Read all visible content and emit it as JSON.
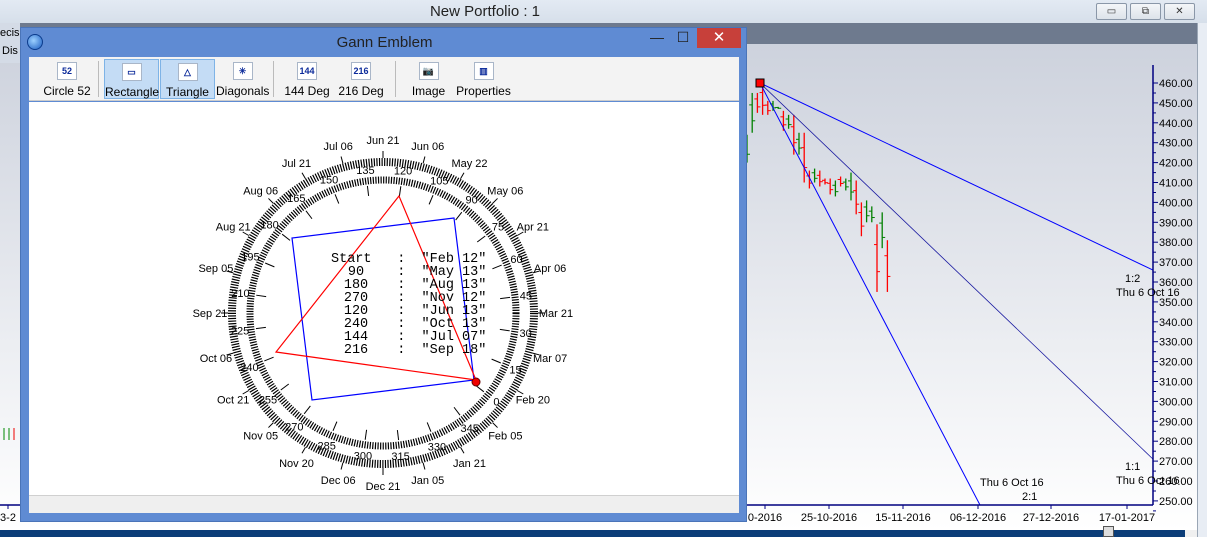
{
  "app": {
    "title": "New Portfolio : 1",
    "left_tabs": [
      "ecis",
      "Dis"
    ]
  },
  "window_buttons": {
    "minimize": "▭",
    "restore": "⧉",
    "close": "✕"
  },
  "gann": {
    "title": "Gann Emblem",
    "title_buttons": {
      "minimize": "—",
      "maximize": "☐",
      "close": "✕"
    },
    "toolbar": [
      {
        "label": "Circle 52",
        "icon": "circle-52-icon",
        "glyph": "52",
        "active": false
      },
      {
        "label": "Rectangle",
        "icon": "rectangle-icon",
        "glyph": "▭",
        "active": true
      },
      {
        "label": "Triangle",
        "icon": "triangle-icon",
        "glyph": "△",
        "active": true
      },
      {
        "label": "Diagonals",
        "icon": "diagonals-icon",
        "glyph": "✳",
        "active": false
      },
      {
        "label": "144 Deg",
        "icon": "144-deg-icon",
        "glyph": "144",
        "active": false
      },
      {
        "label": "216 Deg",
        "icon": "216-deg-icon",
        "glyph": "216",
        "active": false
      },
      {
        "label": "Image",
        "icon": "camera-icon",
        "glyph": "📷",
        "active": false
      },
      {
        "label": "Properties",
        "icon": "properties-icon",
        "glyph": "▥",
        "active": false
      }
    ],
    "degrees": [
      "0",
      "15",
      "30",
      "45",
      "60",
      "75",
      "90",
      "105",
      "120",
      "135",
      "150",
      "165",
      "180",
      "195",
      "210",
      "225",
      "240",
      "255",
      "270",
      "285",
      "300",
      "315",
      "330",
      "345"
    ],
    "dates": [
      "Feb 20",
      "Mar 07",
      "Mar 21",
      "Apr 06",
      "Apr 21",
      "May 06",
      "May 22",
      "Jun 06",
      "Jun 21",
      "Jul 06",
      "Jul 21",
      "Aug 06",
      "Aug 21",
      "Sep 05",
      "Sep 21",
      "Oct 06",
      "Oct 21",
      "Nov 05",
      "Nov 20",
      "Dec 06",
      "Dec 21",
      "Jan 05",
      "Jan 21",
      "Feb 05"
    ],
    "info": [
      [
        "Start",
        "\"Feb 12\""
      ],
      [
        "90",
        "\"May 13\""
      ],
      [
        "180",
        "\"Aug 13\""
      ],
      [
        "270",
        "\"Nov 12\""
      ],
      [
        "120",
        "\"Jun 13\""
      ],
      [
        "240",
        "\"Oct 13\""
      ],
      [
        "144",
        "\"Jul 07\""
      ],
      [
        "216",
        "\"Sep 18\""
      ]
    ],
    "colors": {
      "rectangle": "#0000ff",
      "triangle": "#ff0000"
    }
  },
  "chart": {
    "y_ticks": [
      "460.00",
      "450.00",
      "440.00",
      "430.00",
      "420.00",
      "410.00",
      "400.00",
      "390.00",
      "380.00",
      "370.00",
      "360.00",
      "350.00",
      "340.00",
      "330.00",
      "320.00",
      "310.00",
      "300.00",
      "290.00",
      "280.00",
      "270.00",
      "260.00",
      "250.00"
    ],
    "x_ticks": [
      "3-2",
      "0-2016",
      "25-10-2016",
      "15-11-2016",
      "06-12-2016",
      "27-12-2016",
      "17-01-2017"
    ],
    "fan_labels": [
      {
        "ratio": "1:2",
        "date": "Thu 6 Oct 16"
      },
      {
        "ratio": "1:1",
        "date": "Thu 6 Oct 16"
      },
      {
        "ratio": "2:1",
        "date": "Thu 6 Oct 16"
      }
    ],
    "fan_end_prices": {
      "1:2": 366,
      "1:1": 271
    },
    "colors": {
      "up": "#008000",
      "down": "#ff0000",
      "fan": "#0000ff",
      "anchor": "#ff0000"
    },
    "bars": [
      [
        434,
        420,
        "up"
      ],
      [
        455,
        435,
        "up"
      ],
      [
        455,
        445,
        "down"
      ],
      [
        460,
        444,
        "down"
      ],
      [
        451,
        444,
        "down"
      ],
      [
        451,
        446,
        "up"
      ],
      [
        448,
        447,
        "up"
      ],
      [
        446,
        436,
        "down"
      ],
      [
        444,
        437,
        "up"
      ],
      [
        444,
        424,
        "down"
      ],
      [
        435,
        424,
        "up"
      ],
      [
        435,
        410,
        "down"
      ],
      [
        416,
        407,
        "down"
      ],
      [
        417,
        410,
        "up"
      ],
      [
        416,
        408,
        "down"
      ],
      [
        412,
        409,
        "down"
      ],
      [
        412,
        404,
        "down"
      ],
      [
        411,
        403,
        "up"
      ],
      [
        413,
        408,
        "down"
      ],
      [
        412,
        406,
        "up"
      ],
      [
        415,
        401,
        "up"
      ],
      [
        411,
        394,
        "down"
      ],
      [
        400,
        383,
        "down"
      ],
      [
        401,
        390,
        "up"
      ],
      [
        398,
        390,
        "up"
      ],
      [
        389,
        355,
        "down"
      ],
      [
        395,
        377,
        "up"
      ],
      [
        381,
        355,
        "down"
      ]
    ]
  }
}
